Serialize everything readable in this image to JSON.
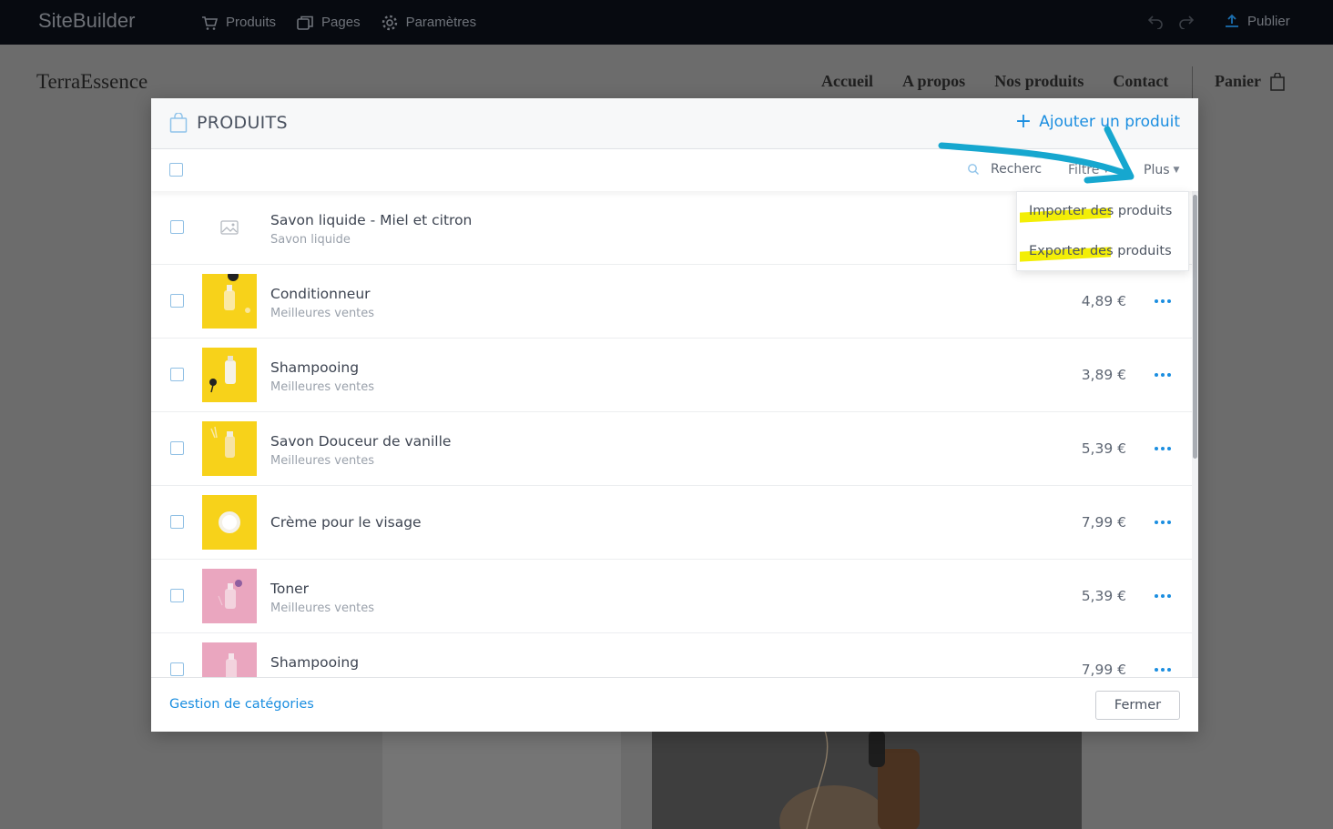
{
  "app": {
    "brand": "SiteBuilder",
    "nav": [
      {
        "label": "Produits",
        "icon": "cart-icon"
      },
      {
        "label": "Pages",
        "icon": "pages-icon"
      },
      {
        "label": "Paramètres",
        "icon": "gear-icon"
      }
    ],
    "publish_label": "Publier"
  },
  "site": {
    "logo": "TerraEssence",
    "nav": [
      "Accueil",
      "A propos",
      "Nos produits",
      "Contact"
    ],
    "cart_label": "Panier"
  },
  "modal": {
    "title": "PRODUITS",
    "add_product_label": "Ajouter un produit",
    "search_placeholder": "Recherc",
    "filter_label": "Filtre",
    "more_label": "Plus",
    "more_menu": [
      "Importer des produits",
      "Exporter des produits"
    ],
    "products": [
      {
        "name": "Savon liquide - Miel et citron",
        "category": "Savon liquide",
        "price": "",
        "thumb": "placeholder"
      },
      {
        "name": "Conditionneur",
        "category": "Meilleures ventes",
        "price": "4,89 €",
        "thumb": "yellow"
      },
      {
        "name": "Shampooing",
        "category": "Meilleures ventes",
        "price": "3,89 €",
        "thumb": "yellow"
      },
      {
        "name": "Savon Douceur de vanille",
        "category": "Meilleures ventes",
        "price": "5,39 €",
        "thumb": "yellow"
      },
      {
        "name": "Crème pour le visage",
        "category": "",
        "price": "7,99 €",
        "thumb": "yellow"
      },
      {
        "name": "Toner",
        "category": "Meilleures ventes",
        "price": "5,39 €",
        "thumb": "pink"
      },
      {
        "name": "Shampooing",
        "category": "",
        "price": "7,99 €",
        "thumb": "pink"
      }
    ],
    "footer": {
      "categories_link": "Gestion de catégories",
      "close_label": "Fermer"
    }
  },
  "colors": {
    "accent": "#1b8ee0",
    "annotation_arrow": "#16a7cf",
    "highlight": "#f3ee06",
    "thumb_yellow": "#f7d21a",
    "thumb_pink": "#eaa6bf"
  }
}
